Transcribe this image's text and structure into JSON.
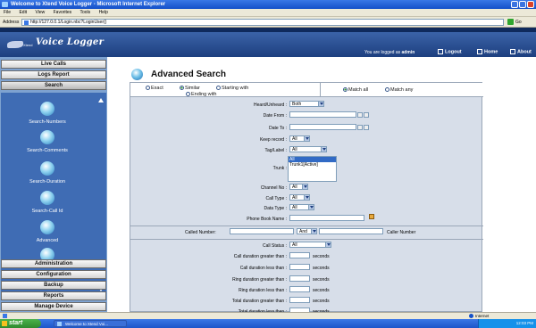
{
  "browser": {
    "title": "Welcome to Xtend Voice Logger - Microsoft Internet Explorer",
    "menu": [
      "File",
      "Edit",
      "View",
      "Favorites",
      "Tools",
      "Help"
    ],
    "address_label": "Address",
    "address_value": "http://127.0.0.1/Login.nbc?LoginUser()",
    "go_label": "Go",
    "status_text": "Internet",
    "taskbar_start": "start",
    "taskbar_item": "Welcome to Xtend Voi...",
    "tray_time": "12:03 PM"
  },
  "app": {
    "logo_small": "Xtend",
    "logo_text": "Voice Logger",
    "login_prefix": "You are logged as",
    "login_user": "admin",
    "links": {
      "logout": "Logout",
      "home": "Home",
      "about": "About"
    }
  },
  "nav": {
    "live_calls": "Live Calls",
    "logs_report": "Logs Report",
    "search": "Search",
    "search_items": [
      "Search-Numbers",
      "Search-Comments",
      "Search-Duration",
      "Search-Call Id",
      "Advanced"
    ],
    "administration": "Administration",
    "configuration": "Configuration",
    "backup": "Backup",
    "reports": "Reports",
    "manage_device": "Manage Device"
  },
  "page": {
    "title": "Advanced Search",
    "match_types": {
      "exact": "Exact",
      "similar": "Similar",
      "starting": "Starting with",
      "ending": "Ending with"
    },
    "match_logic": {
      "all": "Match all",
      "any": "Match any"
    },
    "fields": {
      "heard": {
        "label": "Heard/Unheard :",
        "value": "Both"
      },
      "date_from": {
        "label": "Date From :"
      },
      "date_to": {
        "label": "Date To :"
      },
      "keep_record": {
        "label": "Keep record :",
        "value": "All"
      },
      "tag_label": {
        "label": "Tag/Label :",
        "value": "All"
      },
      "trunk": {
        "label": "Trunk :",
        "options": [
          "All",
          "Trunk1[Active]"
        ]
      },
      "channel_no": {
        "label": "Channel No :",
        "value": "All"
      },
      "call_type": {
        "label": "Call Type :",
        "value": "All"
      },
      "data_type": {
        "label": "Data Type :",
        "value": "All"
      },
      "phone_book": {
        "label": "Phone Book Name :"
      },
      "called_number": {
        "label": "Called Number:",
        "connector": "And",
        "caller_label": "Caller Number"
      },
      "call_status": {
        "label": "Call Status :",
        "value": "All"
      },
      "call_dur_gt": {
        "label": "Call duration greater than :",
        "unit": "seconds"
      },
      "call_dur_lt": {
        "label": "Call duration less than :",
        "unit": "seconds"
      },
      "ring_dur_gt": {
        "label": "Ring duration greater than :",
        "unit": "seconds"
      },
      "ring_dur_lt": {
        "label": "Ring duration less than :",
        "unit": "seconds"
      },
      "total_dur_gt": {
        "label": "Total duration greater than :",
        "unit": "seconds"
      },
      "total_dur_lt": {
        "label": "Total duration less than :",
        "unit": "seconds"
      }
    }
  }
}
